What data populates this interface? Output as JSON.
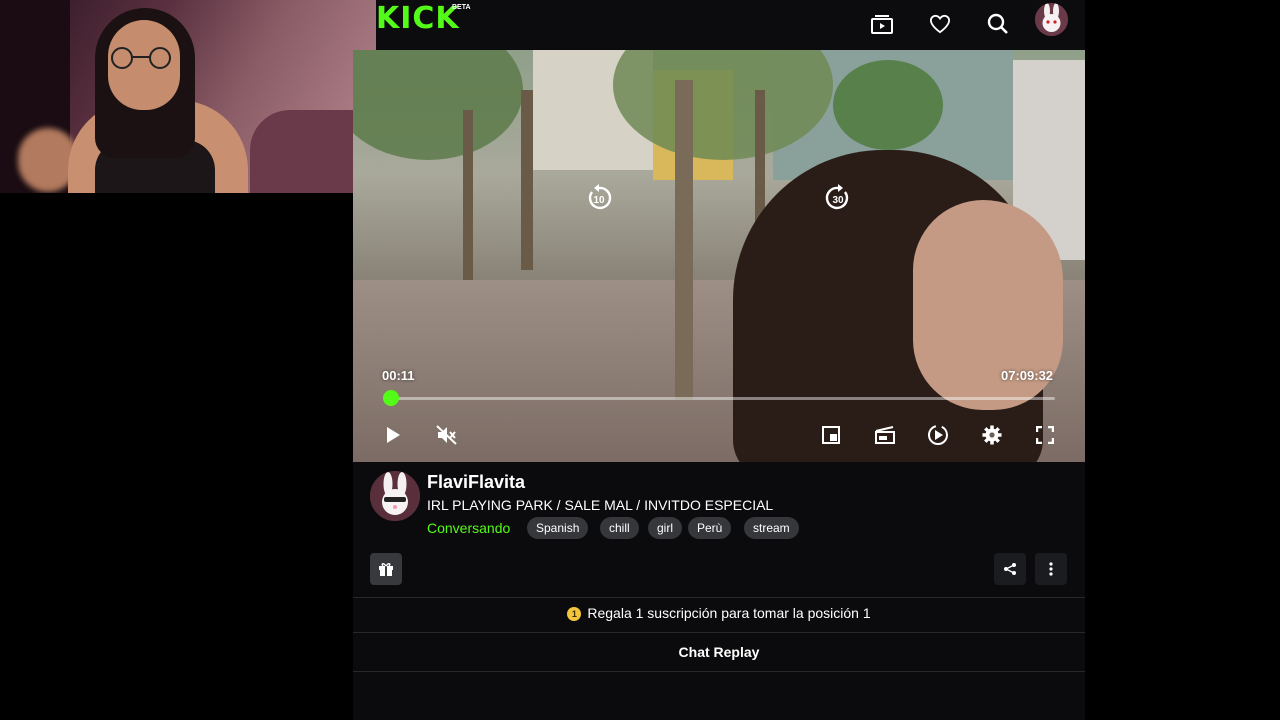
{
  "header": {
    "logo": "KICK",
    "beta": "BETA",
    "icons": [
      "clips-icon",
      "heart-icon",
      "search-icon",
      "user-avatar"
    ]
  },
  "video": {
    "current_time": "00:11",
    "duration": "07:09:32",
    "progress": 0.0004,
    "skip_back_label": "10",
    "skip_forward_label": "30"
  },
  "channel": {
    "name": "FlaviFlavita",
    "title": "IRL PLAYING PARK / SALE MAL / INVITDO ESPECIAL",
    "category": "Conversando",
    "tags": [
      "Spanish",
      "chill",
      "girl",
      "Perù",
      "stream"
    ]
  },
  "gift": {
    "badge": "1",
    "text": "Regala 1 suscripción para tomar la posición 1"
  },
  "chat": {
    "replay_label": "Chat Replay"
  },
  "colors": {
    "accent": "#53fc18",
    "background": "#0b0b0d",
    "tag_bg": "#35373a"
  }
}
